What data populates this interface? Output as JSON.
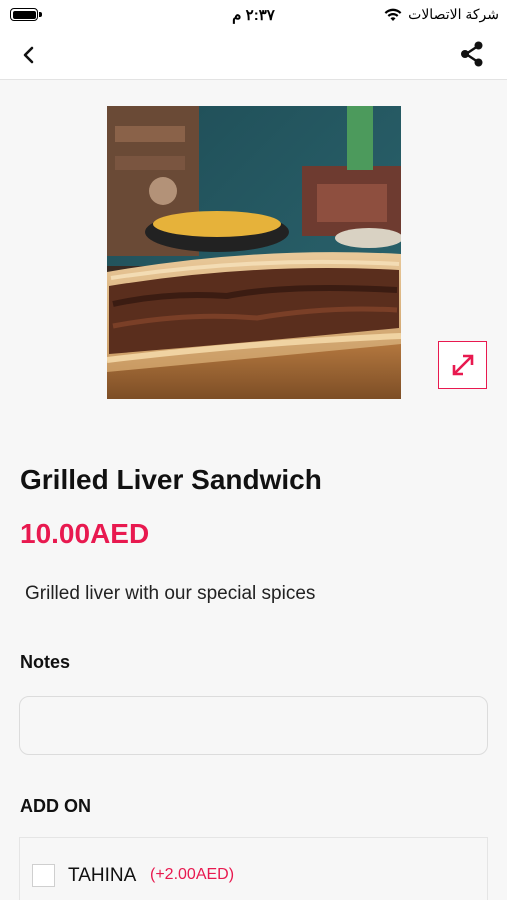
{
  "status_bar": {
    "carrier": "شركة الاتصالات",
    "time": "٢:٣٧ م"
  },
  "nav": {
    "back_icon": "chevron-left-icon",
    "share_icon": "share-icon"
  },
  "product": {
    "image_alt": "Grilled Liver Sandwich",
    "name": "Grilled Liver Sandwich",
    "price": "10.00AED",
    "description": "Grilled liver with our special spices",
    "expand_icon": "expand-arrows-icon"
  },
  "notes": {
    "label": "Notes",
    "value": "",
    "placeholder": ""
  },
  "addons": {
    "label": "ADD ON",
    "items": [
      {
        "name": "TAHINA",
        "price": "(+2.00AED)",
        "checked": false
      }
    ]
  },
  "colors": {
    "accent": "#e8194f",
    "background": "#f7f7f7"
  }
}
